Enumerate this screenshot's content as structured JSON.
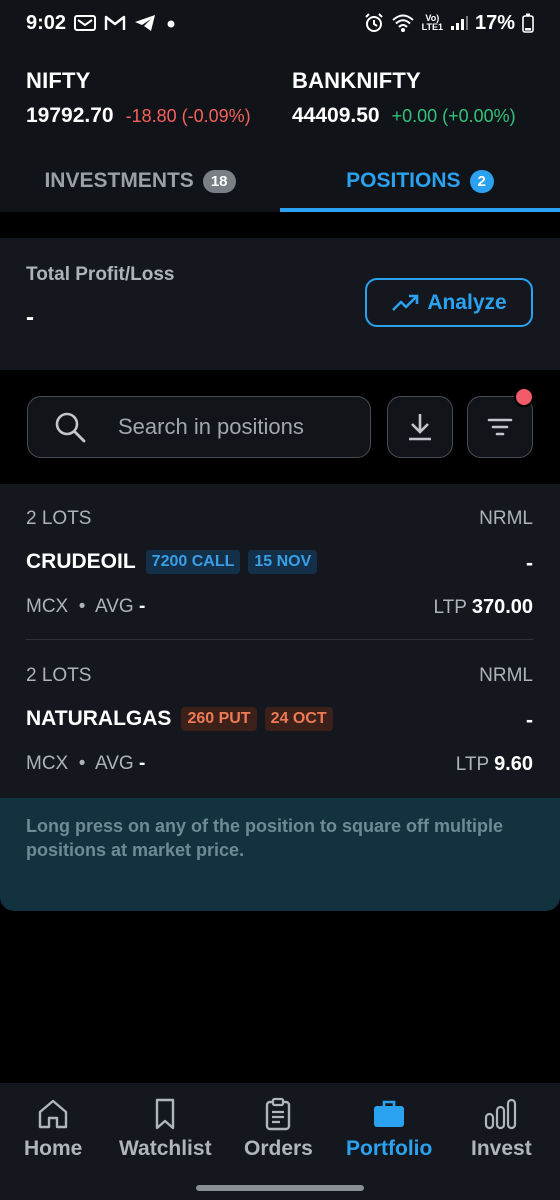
{
  "status_bar": {
    "time": "9:02",
    "battery": "17%",
    "network_label_top": "Vo)",
    "network_label_bottom": "LTE1"
  },
  "market": {
    "nifty": {
      "name": "NIFTY",
      "value": "19792.70",
      "change": "-18.80 (-0.09%)"
    },
    "banknifty": {
      "name": "BANKNIFTY",
      "value": "44409.50",
      "change": "+0.00 (+0.00%)"
    }
  },
  "tabs": [
    {
      "label": "INVESTMENTS",
      "count": "18",
      "active": false
    },
    {
      "label": "POSITIONS",
      "count": "2",
      "active": true
    }
  ],
  "summary": {
    "label": "Total Profit/Loss",
    "value": "-",
    "analyze_label": "Analyze"
  },
  "search": {
    "placeholder": "Search in positions",
    "value": ""
  },
  "positions": [
    {
      "lots": "2 LOTS",
      "product": "NRML",
      "symbol": "CRUDEOIL",
      "strike_tag": "7200 CALL",
      "expiry_tag": "15 NOV",
      "pnl": "-",
      "exchange": "MCX",
      "avg_label": "AVG",
      "avg_value": "-",
      "ltp_label": "LTP",
      "ltp_value": "370.00"
    },
    {
      "lots": "2 LOTS",
      "product": "NRML",
      "symbol": "NATURALGAS",
      "strike_tag": "260 PUT",
      "expiry_tag": "24 OCT",
      "pnl": "-",
      "exchange": "MCX",
      "avg_label": "AVG",
      "avg_value": "-",
      "ltp_label": "LTP",
      "ltp_value": "9.60"
    }
  ],
  "info_text": "Long press on any of the position to square off multiple positions at market price.",
  "bottom_nav": [
    {
      "label": "Home",
      "icon": "home-icon"
    },
    {
      "label": "Watchlist",
      "icon": "bookmark-icon"
    },
    {
      "label": "Orders",
      "icon": "clipboard-icon"
    },
    {
      "label": "Portfolio",
      "icon": "briefcase-icon",
      "active": true
    },
    {
      "label": "Invest",
      "icon": "bars-icon"
    }
  ],
  "colors": {
    "accent": "#2aa2f0",
    "negative": "#f4605a",
    "positive": "#33c27a",
    "call_tag": "#3a9ee6",
    "put_tag": "#f07a56"
  }
}
